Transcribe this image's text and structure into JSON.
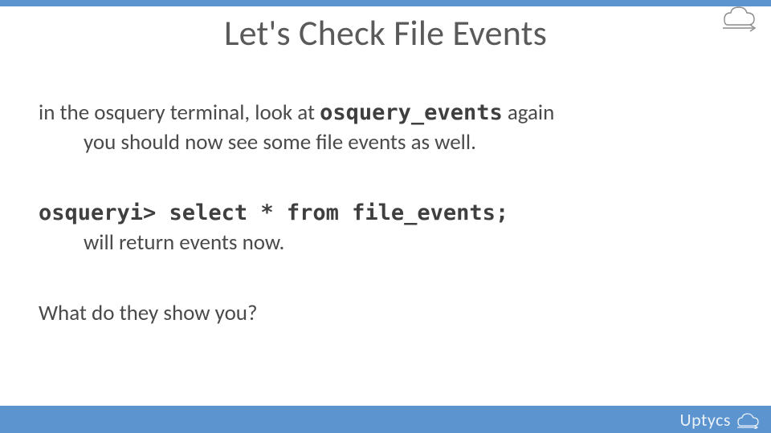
{
  "title": "Let's Check File Events",
  "body": {
    "line1_pre": "in the osquery terminal, look at ",
    "line1_emph": "osquery_events",
    "line1_post": " again",
    "line1_sub": "you should now see some file events as well.",
    "cmd_prompt": "osqueryi> select * from file_events;",
    "cmd_sub": "will return events now.",
    "question": "What do they show you?"
  },
  "brand": {
    "name": "Uptycs"
  }
}
